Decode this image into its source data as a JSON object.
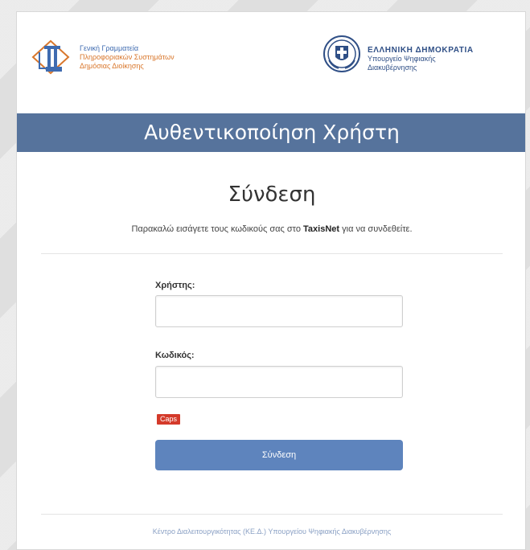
{
  "header": {
    "left_logo": {
      "line1": "Γενική Γραμματεία",
      "line2": "Πληροφοριακών Συστημάτων",
      "line3": "Δημόσιας Διοίκησης"
    },
    "right_logo": {
      "title": "ΕΛΛΗΝΙΚΗ ΔΗΜΟΚΡΑΤΙΑ",
      "sub1": "Υπουργείο Ψηφιακής",
      "sub2": "Διακυβέρνησης"
    }
  },
  "title_bar": {
    "text": "Αυθεντικοποίηση Χρήστη"
  },
  "login": {
    "title": "Σύνδεση",
    "instruction_before": "Παρακαλώ εισάγετε τους κωδικούς σας στο",
    "instruction_bold": "TaxisNet",
    "instruction_after": "για να συνδεθείτε.",
    "username_label": "Χρήστης:",
    "username_value": "",
    "password_label": "Κωδικός:",
    "password_value": "",
    "caps_lock_badge": "Caps",
    "submit_label": "Σύνδεση"
  },
  "footer": {
    "text": "Κέντρο Διαλειτουργικότητας (ΚΕ.Δ.) Υπουργείου Ψηφιακής Διακυβέρνησης"
  },
  "colors": {
    "title_bar": "#56739c",
    "button": "#5e84bd",
    "error_badge": "#d43a2a",
    "footer_text": "#8aa0c4",
    "gov_text": "#2f4f86"
  }
}
